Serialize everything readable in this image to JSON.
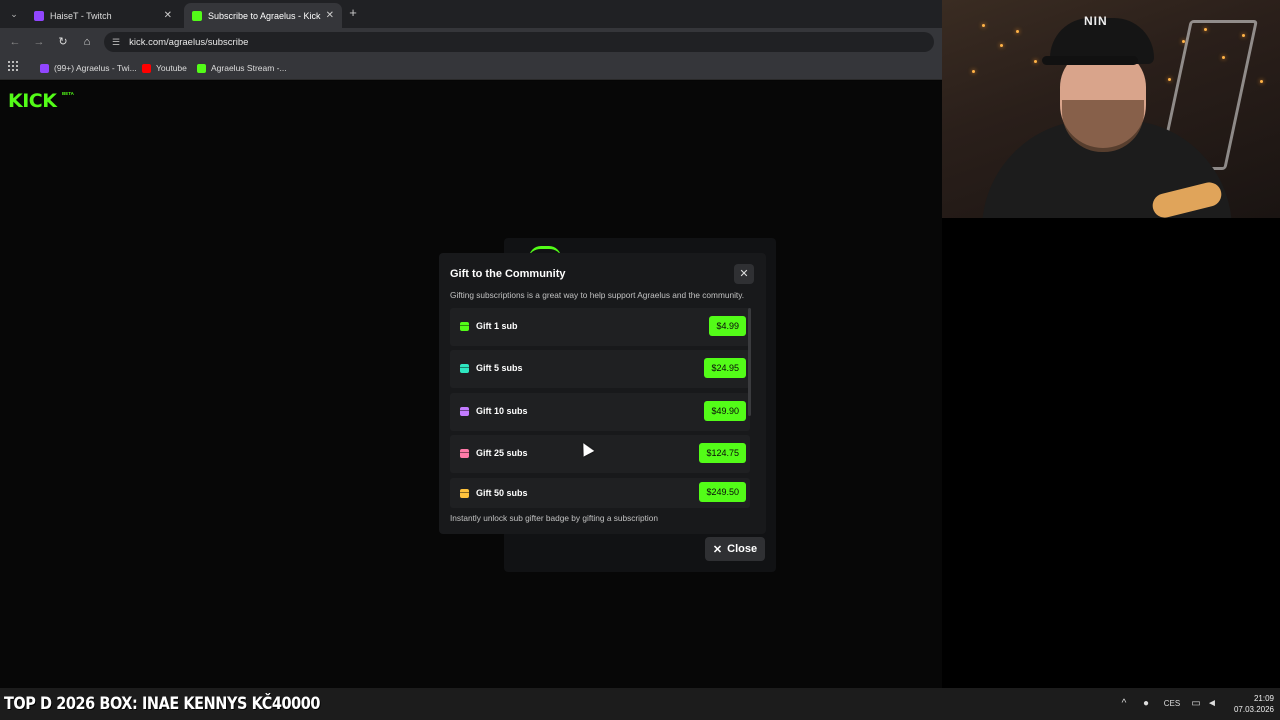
{
  "browser": {
    "tabs": [
      {
        "title": "HaiseT - Twitch",
        "favicon_color": "#9146ff"
      },
      {
        "title": "Subscribe to Agraelus - Kick Str",
        "favicon_color": "#53fc18"
      }
    ],
    "url": "kick.com/agraelus/subscribe",
    "bookmarks": [
      {
        "label": "(99+) Agraelus - Twi...",
        "icon_color": "#9146ff"
      },
      {
        "label": "Youtube",
        "icon_color": "#ff0000"
      },
      {
        "label": "Agraelus Stream -...",
        "icon_color": "#53fc18"
      }
    ]
  },
  "page": {
    "logo_text": "KICK",
    "logo_badge": "BETA"
  },
  "modal": {
    "title": "Gift to the Community",
    "description": "Gifting subscriptions is a great way to help support Agraelus and the community.",
    "options": [
      {
        "label": "Gift 1 sub",
        "price": "$4.99",
        "icon_color": "#53fc18"
      },
      {
        "label": "Gift 5 subs",
        "price": "$24.95",
        "icon_color": "#2ee6c0"
      },
      {
        "label": "Gift 10 subs",
        "price": "$49.90",
        "icon_color": "#c27bff"
      },
      {
        "label": "Gift 25 subs",
        "price": "$124.75",
        "icon_color": "#ff7aa8"
      },
      {
        "label": "Gift 50 subs",
        "price": "$249.50",
        "icon_color": "#ffc23d"
      }
    ],
    "footer": "Instantly unlock sub gifter badge by gifting a subscription",
    "close_label": "Close"
  },
  "overlay": {
    "ticker": "TOP D 2026 BOX: INAE  KENNYS KČ40000"
  },
  "taskbar": {
    "lang": "CES",
    "time": "21:09",
    "date": "07.03.2026"
  },
  "colors": {
    "accent": "#53fc18"
  }
}
